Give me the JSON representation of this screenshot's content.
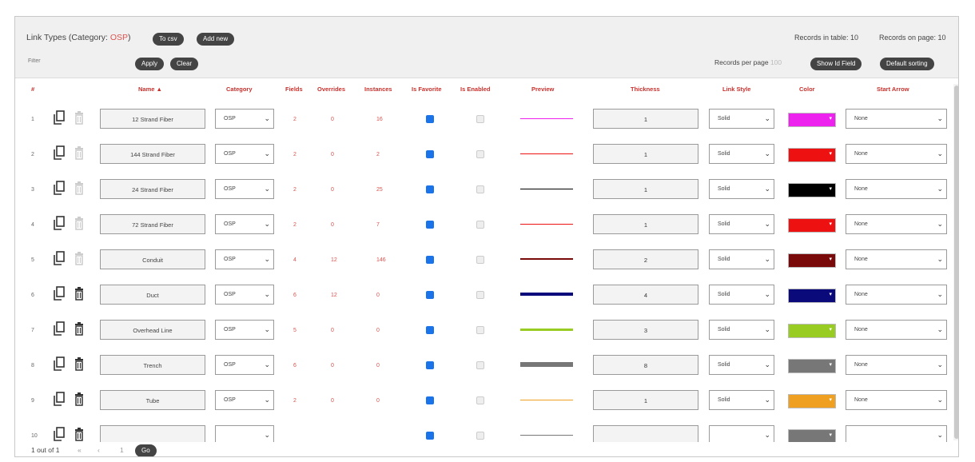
{
  "header": {
    "title_prefix": "Link Types (Category: ",
    "category": "OSP",
    "title_suffix": ")",
    "to_csv": "To csv",
    "add_new": "Add new",
    "records_in_table": "Records in table: 10",
    "records_on_page": "Records on page: 10"
  },
  "filterbar": {
    "filter_placeholder": "Filter",
    "apply": "Apply",
    "clear": "Clear",
    "records_per_page_label": "Records per page",
    "records_per_page_value": "100",
    "show_id_field": "Show Id Field",
    "default_sorting": "Default sorting"
  },
  "columns": {
    "num": "#",
    "name": "Name ▲",
    "category": "Category",
    "fields": "Fields",
    "overrides": "Overrides",
    "instances": "Instances",
    "is_favorite": "Is Favorite",
    "is_enabled": "Is Enabled",
    "preview": "Preview",
    "thickness": "Thickness",
    "link_style": "Link Style",
    "color": "Color",
    "start_arrow": "Start Arrow"
  },
  "rows": [
    {
      "num": "1",
      "name": "12 Strand Fiber",
      "category": "OSP",
      "fields": "2",
      "overrides": "0",
      "instances": "16",
      "favorite": true,
      "enabled": false,
      "thickness": "1",
      "style": "Solid",
      "color": "#ee22ee",
      "start_arrow": "None",
      "delete_enabled": false
    },
    {
      "num": "2",
      "name": "144 Strand Fiber",
      "category": "OSP",
      "fields": "2",
      "overrides": "0",
      "instances": "2",
      "favorite": true,
      "enabled": false,
      "thickness": "1",
      "style": "Solid",
      "color": "#ee1111",
      "start_arrow": "None",
      "delete_enabled": false
    },
    {
      "num": "3",
      "name": "24 Strand Fiber",
      "category": "OSP",
      "fields": "2",
      "overrides": "0",
      "instances": "25",
      "favorite": true,
      "enabled": false,
      "thickness": "1",
      "style": "Solid",
      "color": "#000000",
      "start_arrow": "None",
      "delete_enabled": false
    },
    {
      "num": "4",
      "name": "72 Strand Fiber",
      "category": "OSP",
      "fields": "2",
      "overrides": "0",
      "instances": "7",
      "favorite": true,
      "enabled": false,
      "thickness": "1",
      "style": "Solid",
      "color": "#ee1111",
      "start_arrow": "None",
      "delete_enabled": false
    },
    {
      "num": "5",
      "name": "Conduit",
      "category": "OSP",
      "fields": "4",
      "overrides": "12",
      "instances": "146",
      "favorite": true,
      "enabled": false,
      "thickness": "2",
      "style": "Solid",
      "color": "#7a0a0a",
      "start_arrow": "None",
      "delete_enabled": false
    },
    {
      "num": "6",
      "name": "Duct",
      "category": "OSP",
      "fields": "6",
      "overrides": "12",
      "instances": "0",
      "favorite": true,
      "enabled": false,
      "thickness": "4",
      "style": "Solid",
      "color": "#0a0a7a",
      "start_arrow": "None",
      "delete_enabled": true
    },
    {
      "num": "7",
      "name": "Overhead Line",
      "category": "OSP",
      "fields": "5",
      "overrides": "0",
      "instances": "0",
      "favorite": true,
      "enabled": false,
      "thickness": "3",
      "style": "Solid",
      "color": "#99cc22",
      "start_arrow": "None",
      "delete_enabled": true
    },
    {
      "num": "8",
      "name": "Trench",
      "category": "OSP",
      "fields": "6",
      "overrides": "0",
      "instances": "0",
      "favorite": true,
      "enabled": false,
      "thickness": "8",
      "style": "Solid",
      "color": "#777777",
      "start_arrow": "None",
      "delete_enabled": true
    },
    {
      "num": "9",
      "name": "Tube",
      "category": "OSP",
      "fields": "2",
      "overrides": "0",
      "instances": "0",
      "favorite": true,
      "enabled": false,
      "thickness": "1",
      "style": "Solid",
      "color": "#f0a020",
      "start_arrow": "None",
      "delete_enabled": true
    },
    {
      "num": "10",
      "name": "",
      "category": "",
      "fields": "",
      "overrides": "",
      "instances": "",
      "favorite": true,
      "enabled": false,
      "thickness": "",
      "style": "",
      "color": "#777777",
      "start_arrow": "",
      "delete_enabled": true
    }
  ],
  "footer": {
    "page_info": "1 out of 1",
    "first": "«",
    "prev": "‹",
    "page_input": "1",
    "go": "Go"
  }
}
